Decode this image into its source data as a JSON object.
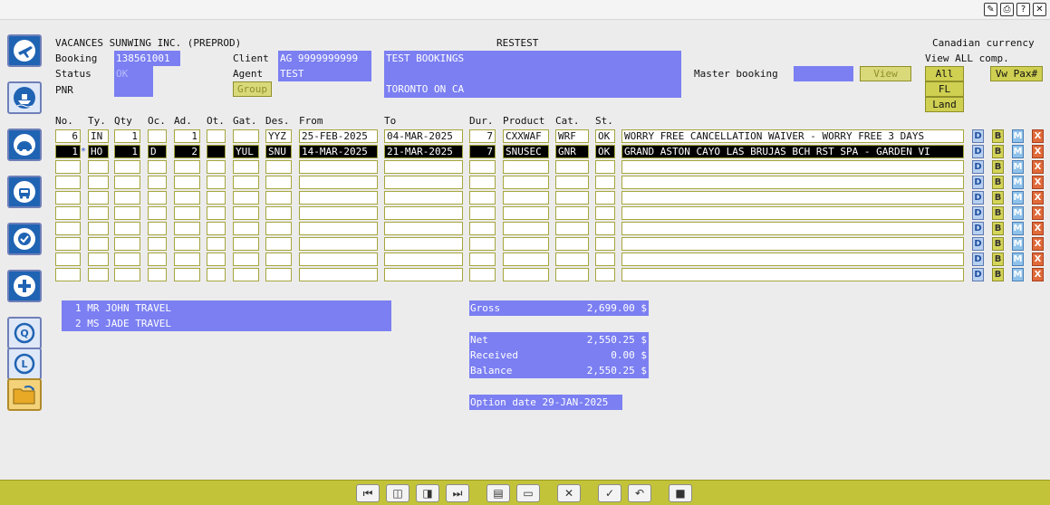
{
  "window": {
    "icons": [
      "edit-icon",
      "print-icon",
      "help-icon",
      "close-icon"
    ],
    "icon_glyphs": [
      "✎",
      "⎙",
      "?",
      "✕"
    ]
  },
  "sidebar": {
    "items": [
      "flight-icon",
      "cruise-icon",
      "car-rental-icon",
      "car-icon",
      "insurance-icon",
      "add-icon",
      "query-search-icon",
      "log-history-icon",
      "open-folder-icon"
    ]
  },
  "header": {
    "company": "VACANCES SUNWING INC. (PREPROD)",
    "system": "RESTEST",
    "currency": "Canadian currency",
    "view_all_comp": "View ALL comp."
  },
  "booking": {
    "booking_label": "Booking",
    "booking_value": "138561001",
    "status_label": "Status",
    "status_value": "OK",
    "pnr_label": "PNR",
    "pnr_value": "",
    "client_label": "Client",
    "client_value": "AG 9999999999",
    "agent_label": "Agent",
    "agent_value": "TEST",
    "group_button": "Group",
    "client_name": "TEST BOOKINGS",
    "client_city": "TORONTO ON CA",
    "master_booking_label": "Master booking",
    "master_booking_value": "",
    "view_button": "View",
    "all_button": "All",
    "fl_button": "FL",
    "land_button": "Land",
    "vw_pax_button": "Vw Pax#"
  },
  "table": {
    "headers": [
      "No.",
      "Ty.",
      "Qty",
      "Oc.",
      "Ad.",
      "Ot.",
      "Gat.",
      "Des.",
      "From",
      "To",
      "Dur.",
      "Product",
      "Cat.",
      "St."
    ],
    "rows": [
      {
        "no": "6",
        "ty": "IN",
        "qty": "1",
        "oc": "",
        "ad": "1",
        "ot": "",
        "gat": "",
        "des": "YYZ",
        "from": "25-FEB-2025",
        "to": "04-MAR-2025",
        "dur": "7",
        "product": "CXXWAF",
        "cat": "WRF",
        "st": "OK",
        "desc": "WORRY FREE CANCELLATION WAIVER - WORRY FREE 3 DAYS",
        "selected": false
      },
      {
        "no": "1",
        "ty": "HO",
        "qty": "1",
        "oc": "D",
        "ad": "2",
        "ot": "",
        "gat": "YUL",
        "des": "SNU",
        "from": "14-MAR-2025",
        "to": "21-MAR-2025",
        "dur": "7",
        "product": "SNUSEC",
        "cat": "GNR",
        "st": "OK",
        "desc": "GRAND ASTON CAYO LAS BRUJAS BCH RST SPA - GARDEN VI",
        "selected": true
      }
    ],
    "row_marker": "*",
    "actions": {
      "d": "D",
      "b": "B",
      "m": "M",
      "x": "X"
    }
  },
  "passengers": [
    {
      "line": "1 MR JOHN TRAVEL"
    },
    {
      "line": "2 MS JADE TRAVEL"
    }
  ],
  "totals": {
    "gross_label": "Gross",
    "gross_value": "2,699.00 $",
    "net_label": "Net",
    "net_value": "2,550.25 $",
    "received_label": "Received",
    "received_value": "0.00 $",
    "balance_label": "Balance",
    "balance_value": "2,550.25 $",
    "option_date": "Option date 29-JAN-2025"
  },
  "toolbar": {
    "buttons": [
      {
        "name": "first-record-icon",
        "glyph": "⏮"
      },
      {
        "name": "previous-record-icon",
        "glyph": "◫"
      },
      {
        "name": "next-record-icon",
        "glyph": "◨"
      },
      {
        "name": "last-record-icon",
        "glyph": "⏭"
      },
      {
        "name": "open-book-icon",
        "glyph": "▤"
      },
      {
        "name": "display-icon",
        "glyph": "▭"
      },
      {
        "name": "cancel-icon",
        "glyph": "✕"
      },
      {
        "name": "confirm-icon",
        "glyph": "✓"
      },
      {
        "name": "undo-icon",
        "glyph": "↶"
      },
      {
        "name": "stop-icon",
        "glyph": "■"
      }
    ]
  },
  "colors": {
    "field_bg": "#7b7ff2",
    "toolbar_bg": "#c3c33a",
    "sidebar_blue": "#1f63b3"
  }
}
